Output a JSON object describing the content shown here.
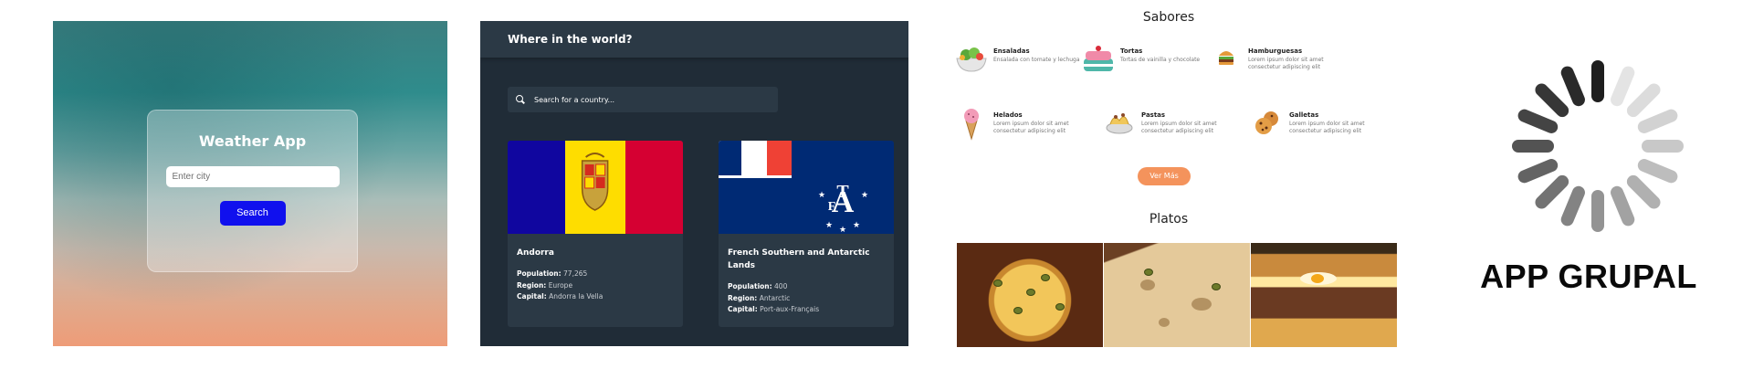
{
  "weather_app": {
    "title": "Weather App",
    "city_placeholder": "Enter city",
    "search_label": "Search",
    "colors": {
      "button": "#1010ee"
    }
  },
  "countries_app": {
    "title": "Where in the world?",
    "search_placeholder": "Search for a country...",
    "labels": {
      "population": "Population:",
      "region": "Region:",
      "capital": "Capital:"
    },
    "countries": [
      {
        "name": "Andorra",
        "population": "77,265",
        "region": "Europe",
        "capital": "Andorra la Vella",
        "flag_icon": "andorra-flag"
      },
      {
        "name": "French Southern and Antarctic Lands",
        "population": "400",
        "region": "Antarctic",
        "capital": "Port-aux-Français",
        "flag_icon": "taaf-flag"
      }
    ],
    "colors": {
      "background": "#202c37",
      "elements": "#2b3945"
    }
  },
  "sabores_app": {
    "title": "Sabores",
    "flavors": [
      {
        "name": "Ensaladas",
        "description": "Ensalada con tomate y lechuga",
        "icon": "salad-icon"
      },
      {
        "name": "Tortas",
        "description": "Tortas de vainilla y chocolate",
        "icon": "cake-icon"
      },
      {
        "name": "Hamburguesas",
        "description": "Lorem ipsum dolor sit amet consectetur adipiscing elit",
        "icon": "burger-icon"
      },
      {
        "name": "Helados",
        "description": "Lorem ipsum dolor sit amet consectetur adipiscing elit",
        "icon": "ice-cream-icon"
      },
      {
        "name": "Pastas",
        "description": "Lorem ipsum dolor sit amet consectetur adipiscing elit",
        "icon": "pasta-icon"
      },
      {
        "name": "Galletas",
        "description": "Lorem ipsum dolor sit amet consectetur adipiscing elit",
        "icon": "cookies-icon"
      }
    ],
    "more_label": "Ver Más",
    "dishes_title": "Platos",
    "dishes": [
      "pizza",
      "cheese",
      "burger"
    ],
    "colors": {
      "button": "#f4935c"
    }
  },
  "app_grupal": {
    "title": "APP GRUPAL",
    "icon": "loading-spinner-icon"
  }
}
